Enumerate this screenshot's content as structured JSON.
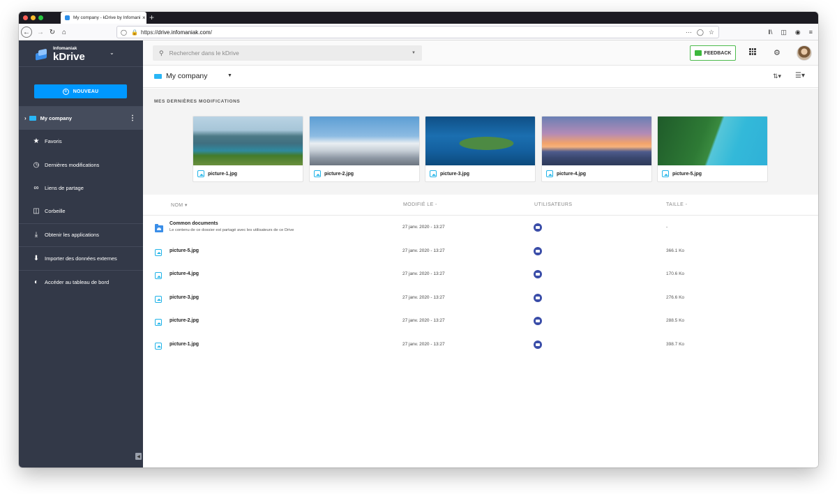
{
  "browser": {
    "tab_title": "My company - kDrive by Infomaniak",
    "tab_close": "×",
    "new_tab": "+",
    "url_prefix": "https://",
    "url_host": "drive.infomaniak.com",
    "url_path": "/",
    "url_more": "···"
  },
  "brand": {
    "company": "Infomaniak",
    "product": "kDrive"
  },
  "sidebar": {
    "new_button": "NOUVEAU",
    "items": [
      {
        "label": "My company",
        "icon": "drive-icon"
      },
      {
        "label": "Favoris",
        "icon": "star-icon"
      },
      {
        "label": "Dernières modifications",
        "icon": "clock-icon"
      },
      {
        "label": "Liens de partage",
        "icon": "link-icon"
      },
      {
        "label": "Corbeille",
        "icon": "trash-icon"
      },
      {
        "label": "Obtenir les applications",
        "icon": "download-icon"
      },
      {
        "label": "Importer des données externes",
        "icon": "import-icon"
      },
      {
        "label": "Accéder au tableau de bord",
        "icon": "dashboard-icon"
      }
    ]
  },
  "topbar": {
    "search_placeholder": "Rechercher dans le kDrive",
    "feedback_label": "FEEDBACK"
  },
  "breadcrumb": {
    "title": "My company"
  },
  "recent": {
    "title": "MES DERNIÈRES MODIFICATIONS",
    "cards": [
      {
        "name": "picture-1.jpg"
      },
      {
        "name": "picture-2.jpg"
      },
      {
        "name": "picture-3.jpg"
      },
      {
        "name": "picture-4.jpg"
      },
      {
        "name": "picture-5.jpg"
      }
    ]
  },
  "files": {
    "columns": {
      "name": "NOM",
      "name_sort": "▾",
      "modified": "MODIFIÉ LE",
      "modified_sort": "-",
      "users": "UTILISATEURS",
      "size": "TAILLE",
      "size_sort": "-"
    },
    "rows": [
      {
        "name": "Common documents",
        "description": "Le contenu de ce dossier est partagé avec les utilisateurs de ce Drive",
        "modified": "27 janv. 2020 - 13:27",
        "size": "-",
        "type": "folder"
      },
      {
        "name": "picture-5.jpg",
        "modified": "27 janv. 2020 - 13:27",
        "size": "366.1 Ko",
        "type": "image"
      },
      {
        "name": "picture-4.jpg",
        "modified": "27 janv. 2020 - 13:27",
        "size": "170.6 Ko",
        "type": "image"
      },
      {
        "name": "picture-3.jpg",
        "modified": "27 janv. 2020 - 13:27",
        "size": "276.6 Ko",
        "type": "image"
      },
      {
        "name": "picture-2.jpg",
        "modified": "27 janv. 2020 - 13:27",
        "size": "288.5 Ko",
        "type": "image"
      },
      {
        "name": "picture-1.jpg",
        "modified": "27 janv. 2020 - 13:27",
        "size": "398.7 Ko",
        "type": "image"
      }
    ]
  },
  "colors": {
    "sidebar_bg": "#333948",
    "accent_blue": "#0098ff",
    "drive_icon": "#29b6f6",
    "feedback_green": "#4cbb4c",
    "user_badge": "#3a4da8"
  }
}
